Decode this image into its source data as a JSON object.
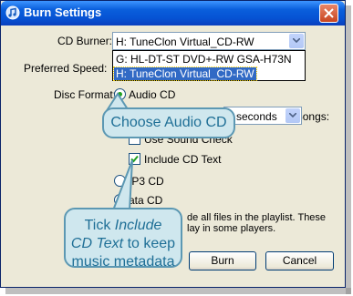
{
  "window": {
    "title": "Burn Settings"
  },
  "cd_burner": {
    "label": "CD Burner:",
    "selected": "H: TuneClon Virtual_CD-RW",
    "options": [
      "G: HL-DT-ST DVD+-RW GSA-H73N",
      "H: TuneClon Virtual_CD-RW"
    ]
  },
  "preferred_speed": {
    "label": "Preferred Speed:"
  },
  "disc_format": {
    "label": "Disc Format:",
    "audio_cd": "Audio CD",
    "gap_label": "ap Between Songs:",
    "gap_value": "2 seconds",
    "sound_check": "Use Sound Check",
    "include_cd_text": "Include CD Text",
    "mp3_cd": "IP3 CD",
    "data_cd": "ata CD"
  },
  "note": {
    "line1": "de all files in the playlist. These",
    "line2": "lay in some players."
  },
  "buttons": {
    "burn": "Burn",
    "cancel": "Cancel"
  },
  "callouts": {
    "choose": "Choose Audio CD",
    "tick_line1_plain": "Tick ",
    "tick_line1_italic": "Include",
    "tick_line2_italic": "CD Text",
    "tick_line2_plain": " to keep",
    "tick_line3": "music metadata"
  },
  "icons": [
    "itunes-app-icon",
    "close-icon",
    "dropdown-arrow-icon",
    "checkmark-icon"
  ]
}
